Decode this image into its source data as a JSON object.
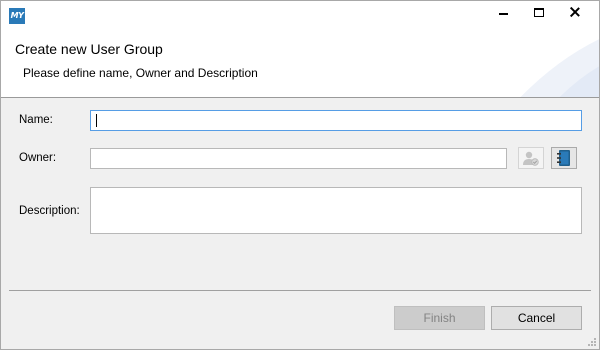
{
  "window": {
    "app_icon_text": "MY",
    "controls": [
      "minimize",
      "maximize",
      "close"
    ]
  },
  "header": {
    "title": "Create new User Group",
    "subtitle": "Please define name, Owner and Description"
  },
  "form": {
    "name": {
      "label": "Name:",
      "value": ""
    },
    "owner": {
      "label": "Owner:",
      "value": ""
    },
    "description": {
      "label": "Description:",
      "value": ""
    }
  },
  "icons": {
    "select_user": "user-select-icon",
    "address_book": "address-book-icon"
  },
  "buttons": {
    "finish": "Finish",
    "cancel": "Cancel"
  },
  "colors": {
    "accent": "#569de5",
    "app_icon": "#2a7ab8"
  }
}
